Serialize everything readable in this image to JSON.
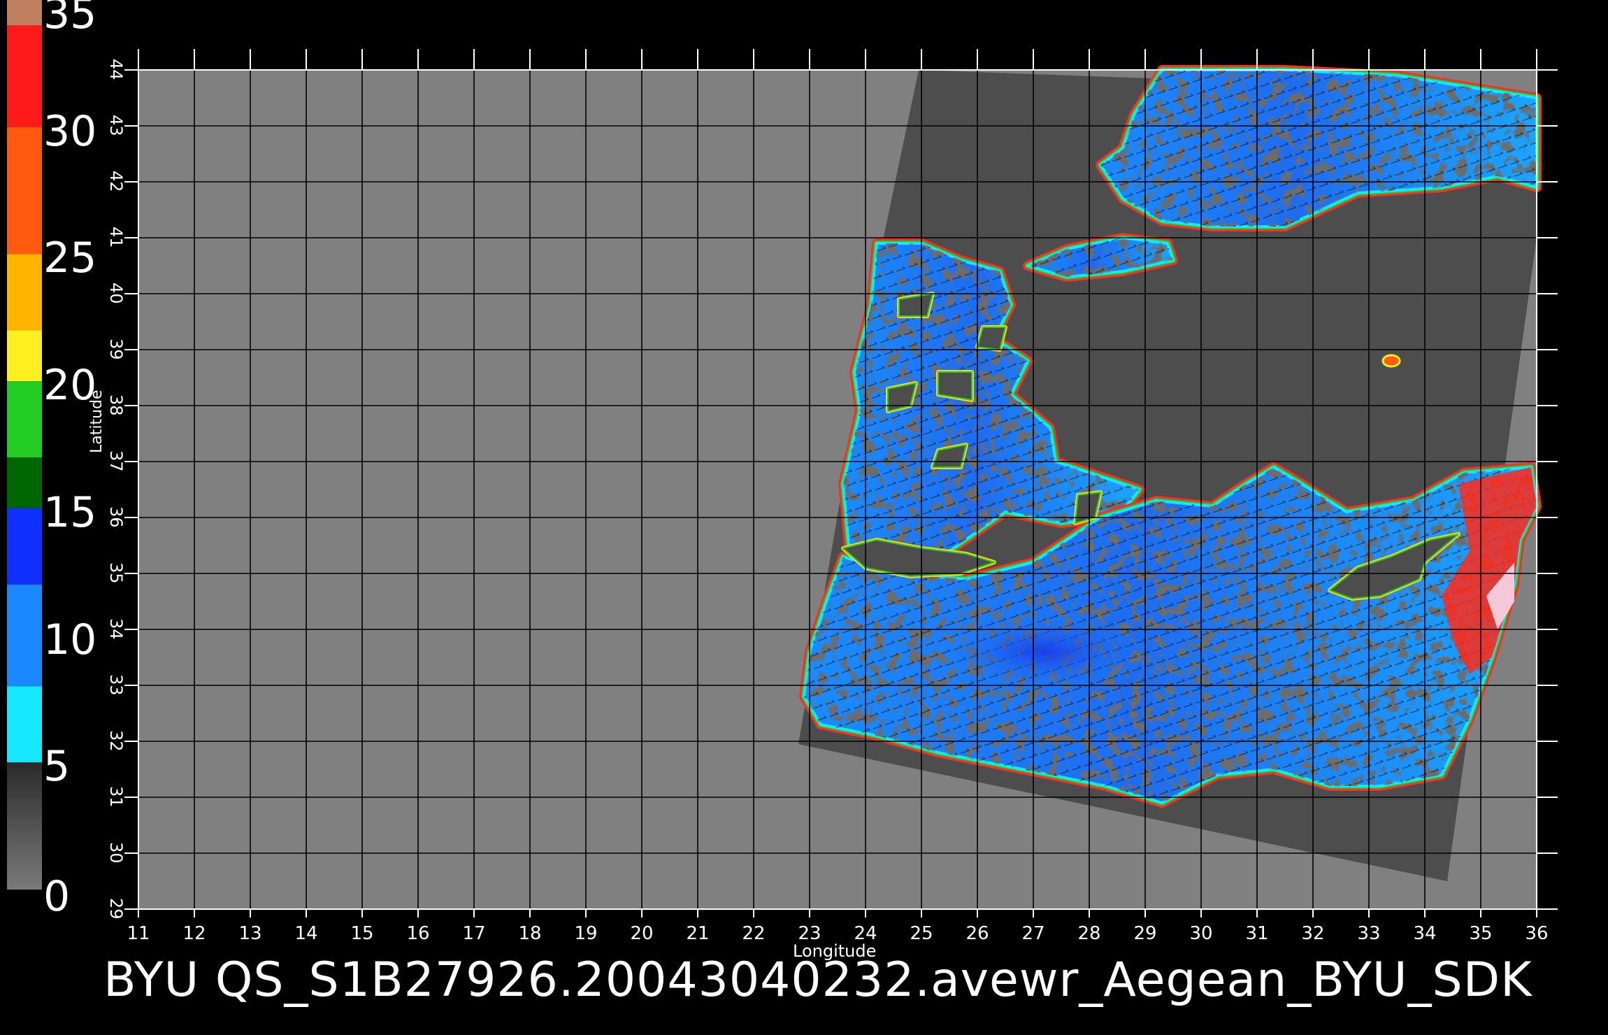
{
  "colorbar": {
    "labels": [
      "35",
      "30",
      "25",
      "20",
      "15",
      "10",
      "5",
      "0"
    ],
    "segments": [
      {
        "from": 35,
        "to": 34,
        "color": "#c08060"
      },
      {
        "from": 34,
        "to": 30,
        "color": "#ff1a1a"
      },
      {
        "from": 30,
        "to": 25,
        "color": "#ff5a10"
      },
      {
        "from": 25,
        "to": 22,
        "color": "#ffb400"
      },
      {
        "from": 22,
        "to": 20,
        "color": "#ffee20"
      },
      {
        "from": 20,
        "to": 17,
        "color": "#22cc22"
      },
      {
        "from": 17,
        "to": 15,
        "color": "#006600"
      },
      {
        "from": 15,
        "to": 12,
        "color": "#1030ff"
      },
      {
        "from": 12,
        "to": 8,
        "color": "#1a88ff"
      },
      {
        "from": 8,
        "to": 5,
        "color": "#18e8ff"
      },
      {
        "from": 5,
        "to": 0,
        "color": "#555555"
      }
    ]
  },
  "map": {
    "lon_range": [
      11,
      36
    ],
    "lat_range": [
      29,
      44
    ],
    "lon_ticks": [
      "11",
      "12",
      "13",
      "14",
      "15",
      "16",
      "17",
      "18",
      "19",
      "20",
      "21",
      "22",
      "23",
      "24",
      "25",
      "26",
      "27",
      "28",
      "29",
      "30",
      "31",
      "32",
      "33",
      "34",
      "35",
      "36"
    ],
    "lat_ticks": [
      "29",
      "30",
      "31",
      "32",
      "33",
      "34",
      "35",
      "36",
      "37",
      "38",
      "39",
      "40",
      "41",
      "42",
      "43",
      "44"
    ],
    "xlabel": "Longitude",
    "ylabel": "Latitude",
    "background_color": "#808080",
    "swath_color": "#4d4d4d",
    "grid_color": "#000000"
  },
  "footer": {
    "title": "BYU  QS_S1B27926.20043040232.avewr_Aegean_BYU_SDK"
  }
}
